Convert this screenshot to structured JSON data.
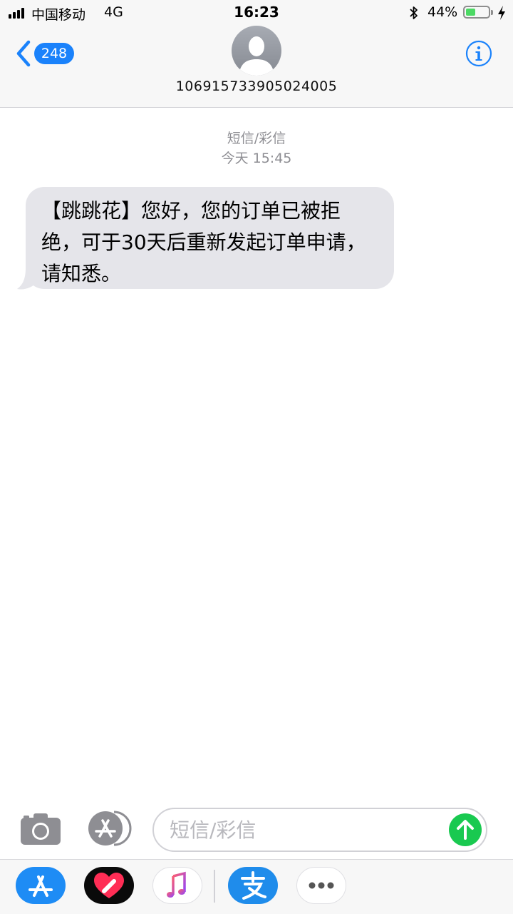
{
  "status_bar": {
    "carrier": "中国移动",
    "network": "4G",
    "time": "16:23",
    "battery_percent": "44%",
    "battery_level": 0.44,
    "icons": [
      "signal-icon",
      "bluetooth-icon",
      "battery-icon",
      "charging-bolt-icon"
    ]
  },
  "header": {
    "unread_count": "248",
    "contact_number": "106915733905024005",
    "icons": [
      "back-chevron-icon",
      "avatar-person-icon",
      "info-icon"
    ]
  },
  "conversation": {
    "type_label": "短信/彩信",
    "timestamp": "今天 15:45",
    "messages": [
      {
        "direction": "incoming",
        "text": "【跳跳花】您好，您的订单已被拒绝，可于30天后重新发起订单申请，请知悉。"
      }
    ]
  },
  "composer": {
    "placeholder": "短信/彩信",
    "value": "",
    "icons": [
      "camera-icon",
      "app-store-icon",
      "send-arrow-icon"
    ]
  },
  "app_drawer": {
    "apps": [
      "app-store-icon",
      "digital-touch-heart-icon",
      "music-note-icon",
      "alipay-icon",
      "more-dots-icon"
    ]
  },
  "colors": {
    "accent_blue": "#1a82fb",
    "send_green": "#19c950",
    "bubble_gray": "#e5e5ea",
    "battery_green": "#4cd964"
  }
}
